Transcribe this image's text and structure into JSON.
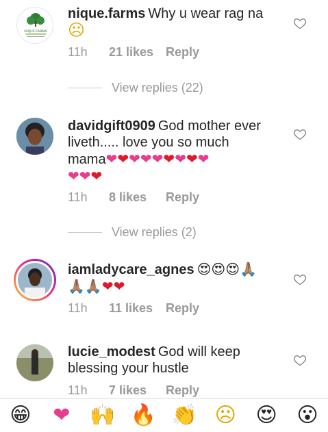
{
  "comments": [
    {
      "username": "nique.farms",
      "text": "Why u wear rag na",
      "emoji_line": "☹",
      "time": "11h",
      "likes": "21 likes",
      "reply": "Reply",
      "avatar_icon": "nique-farms-logo",
      "logo_text": "NIQUE FARMS",
      "view_replies": "View replies (22)"
    },
    {
      "username": "davidgift0909",
      "text_line1": "God mother ever",
      "text_line2": "liveth..... love you so much",
      "text_line3_word": "mama",
      "hearts_line3": [
        "pink",
        "red",
        "pink",
        "pink",
        "pink",
        "red",
        "pink",
        "red",
        "pink"
      ],
      "hearts_line4": [
        "pink",
        "pink",
        "red"
      ],
      "time": "11h",
      "likes": "8 likes",
      "reply": "Reply",
      "avatar_icon": "user-photo",
      "view_replies": "View replies (2)"
    },
    {
      "username": "iamladycare_agnes",
      "emojis_line1": "😍😍😍🙏🏽",
      "emojis_line2": "🙏🏽🙏🏽",
      "hearts_line2": [
        "red",
        "red"
      ],
      "time": "11h",
      "likes": "11 likes",
      "reply": "Reply",
      "avatar_icon": "story-ring-photo"
    },
    {
      "username": "lucie_modest",
      "text_line1": "God will keep",
      "text_line2": "blessing your hustle",
      "time": "11h",
      "likes": "7 likes",
      "reply": "Reply",
      "avatar_icon": "user-photo"
    }
  ],
  "emoji_bar": [
    "😁",
    "❤",
    "🙌",
    "🔥",
    "👏",
    "☹",
    "😍",
    "😮"
  ],
  "colors": {
    "text": "#262626",
    "meta": "#999999",
    "heart_pink": "#e63e8c",
    "heart_red": "#dd1a2a",
    "story_ring": "#ee2a7b"
  }
}
